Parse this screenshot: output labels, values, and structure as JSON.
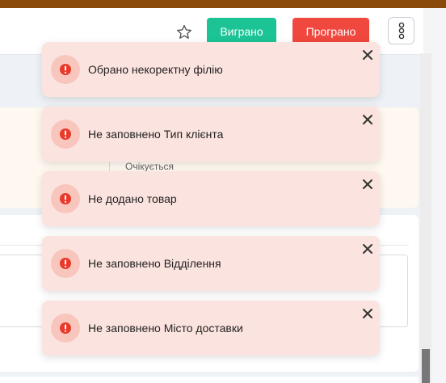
{
  "header": {
    "favorite_icon": "star-outline-icon",
    "win_label": "Виграно",
    "lose_label": "Програно",
    "more_icon": "vertical-dots-icon",
    "colors": {
      "win": "#1cc495",
      "lose": "#f0483e",
      "brand_bar": "#8a4a0a"
    }
  },
  "background": {
    "status_text": "Очікується"
  },
  "toasts": [
    {
      "message": "Обрано некоректну філію",
      "icon": "error-icon",
      "close_icon": "close-icon"
    },
    {
      "message": "Не заповнено Тип клієнта",
      "icon": "error-icon",
      "close_icon": "close-icon"
    },
    {
      "message": "Не додано товар",
      "icon": "error-icon",
      "close_icon": "close-icon"
    },
    {
      "message": "Не заповнено Відділення",
      "icon": "error-icon",
      "close_icon": "close-icon"
    },
    {
      "message": "Не заповнено Місто доставки",
      "icon": "error-icon",
      "close_icon": "close-icon"
    }
  ],
  "toast_colors": {
    "background": "#fbe3df",
    "icon_circle": "#f8c6bd",
    "icon_fill": "#e8392a"
  }
}
